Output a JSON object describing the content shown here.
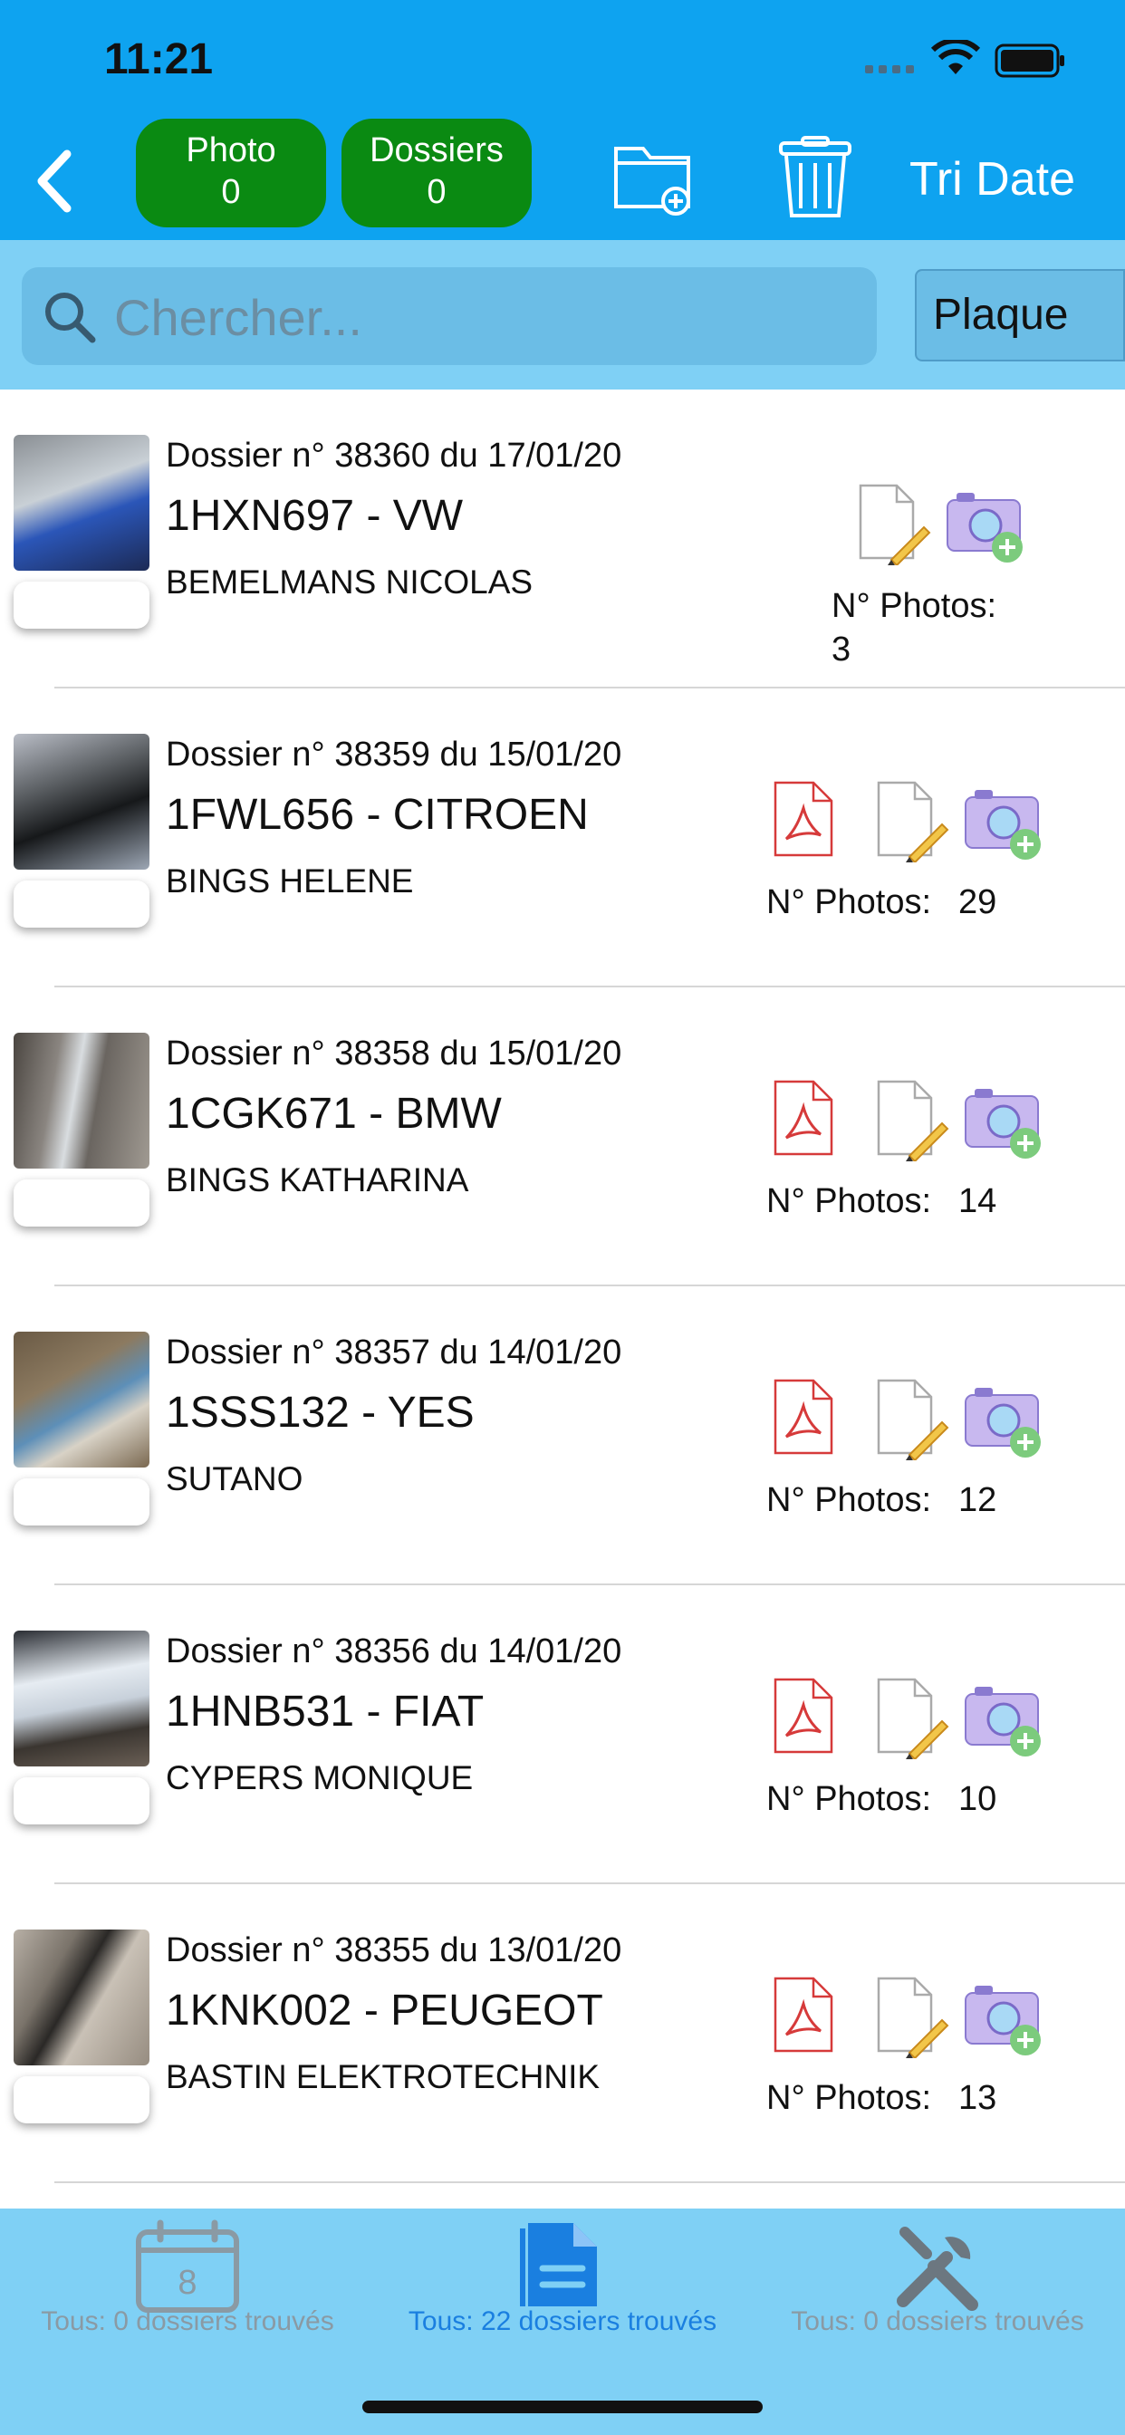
{
  "status": {
    "time": "11:21"
  },
  "header": {
    "photo_label": "Photo",
    "photo_count": "0",
    "dossiers_label": "Dossiers",
    "dossiers_count": "0",
    "sort_label": "Tri Date",
    "icons": [
      "back-chevron-icon",
      "folder-add-icon",
      "trash-icon"
    ]
  },
  "search": {
    "placeholder": "Chercher...",
    "filter_label": "Plaque"
  },
  "dossiers": [
    {
      "title": "Dossier n° 38360 du  17/01/20",
      "plate": "1HXN697  - VW",
      "owner": "BEMELMANS NICOLAS",
      "photos_label": "N° Photos:",
      "photos_count": "3",
      "has_pdf": false
    },
    {
      "title": "Dossier n° 38359 du  15/01/20",
      "plate": "1FWL656  - CITROEN",
      "owner": "BINGS HELENE",
      "photos_label": "N° Photos:",
      "photos_count": "29",
      "has_pdf": true
    },
    {
      "title": "Dossier n° 38358 du  15/01/20",
      "plate": "1CGK671  - BMW",
      "owner": "BINGS KATHARINA",
      "photos_label": "N° Photos:",
      "photos_count": "14",
      "has_pdf": true
    },
    {
      "title": "Dossier n° 38357 du  14/01/20",
      "plate": "1SSS132  - YES",
      "owner": "SUTANO",
      "photos_label": "N° Photos:",
      "photos_count": "12",
      "has_pdf": true
    },
    {
      "title": "Dossier n° 38356 du  14/01/20",
      "plate": "1HNB531  - FIAT",
      "owner": "CYPERS MONIQUE",
      "photos_label": "N° Photos:",
      "photos_count": "10",
      "has_pdf": true
    },
    {
      "title": "Dossier n° 38355 du  13/01/20",
      "plate": "1KNK002  - PEUGEOT",
      "owner": "BASTIN ELEKTROTECHNIK",
      "photos_label": "N° Photos:",
      "photos_count": "13",
      "has_pdf": true
    }
  ],
  "tabs": [
    {
      "label": "Tous: 0 dossiers trouvés",
      "icon": "calendar-icon",
      "active": false
    },
    {
      "label": "Tous: 22 dossiers trouvés",
      "icon": "document-icon",
      "active": true
    },
    {
      "label": "Tous: 0 dossiers trouvés",
      "icon": "tools-icon",
      "active": false
    }
  ],
  "colors": {
    "header": "#0ea3f0",
    "searchbar": "#7fd0f5",
    "pill": "#0a8a12",
    "active_tab": "#1a7fe0"
  }
}
